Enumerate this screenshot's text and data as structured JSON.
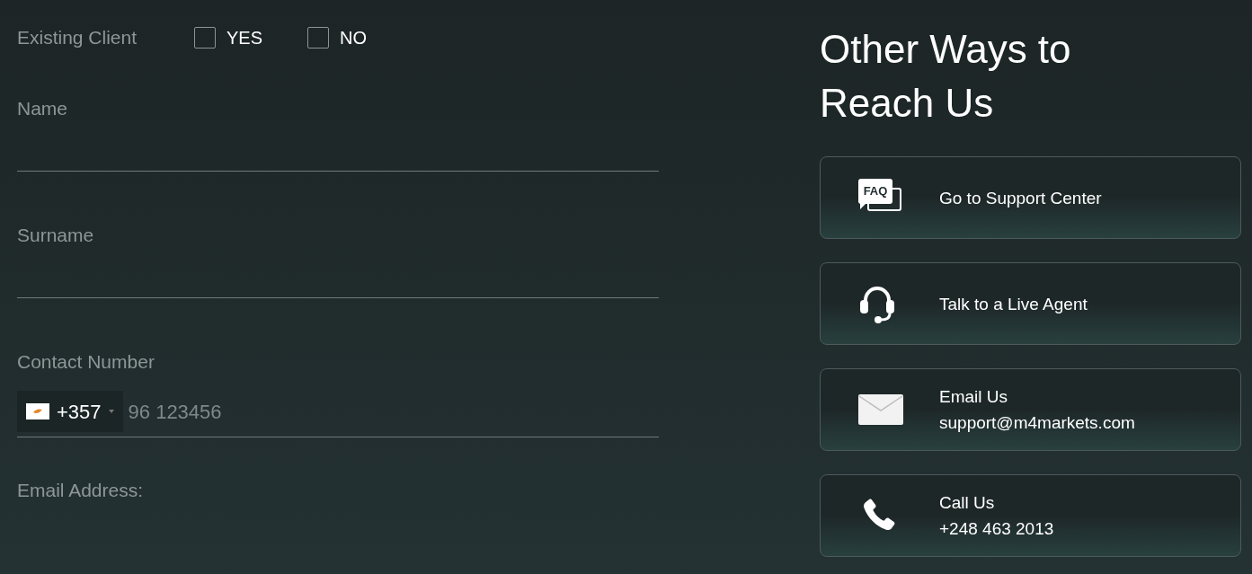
{
  "existing_client": {
    "label": "Existing Client",
    "options": [
      {
        "label": "YES",
        "checked": false
      },
      {
        "label": "NO",
        "checked": false
      }
    ]
  },
  "fields": [
    {
      "kind": "text",
      "label": "Name"
    },
    {
      "kind": "text",
      "label": "Surname"
    },
    {
      "kind": "phone",
      "label": "Contact Number",
      "country_code": "+357",
      "placeholder": "96 123456"
    },
    {
      "kind": "label_only",
      "label": "Email Address:"
    }
  ],
  "contact": {
    "title": "Other Ways to Reach Us",
    "cards": [
      {
        "kind": "faq",
        "icon_text": "FAQ",
        "lines": [
          "Go to Support Center"
        ]
      },
      {
        "kind": "headset",
        "lines": [
          "Talk to a Live Agent"
        ]
      },
      {
        "kind": "envelope",
        "lines": [
          "Email Us",
          "support@m4markets.com"
        ]
      },
      {
        "kind": "phone",
        "lines": [
          "Call Us",
          "+248 463 2013"
        ]
      }
    ]
  }
}
